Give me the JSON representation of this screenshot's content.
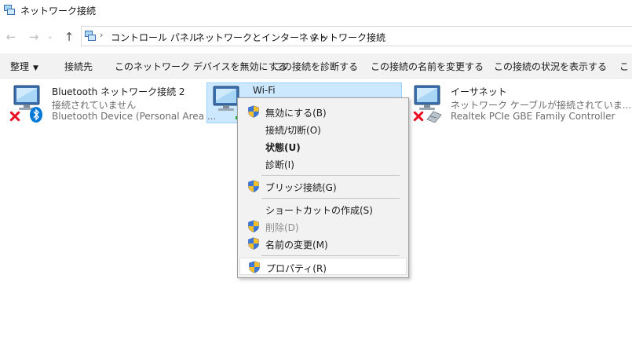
{
  "window": {
    "title": "ネットワーク接続"
  },
  "address": {
    "breadcrumbs": [
      "コントロール パネル",
      "ネットワークとインターネット",
      "ネットワーク接続"
    ]
  },
  "nav": {
    "back_icon": "arrow-left-icon",
    "forward_icon": "arrow-right-icon",
    "recent_icon": "chevron-down-icon",
    "up_icon": "arrow-up-icon"
  },
  "commands": [
    {
      "label": "整理",
      "has_dropdown": true
    },
    {
      "label": "接続先"
    },
    {
      "label": "このネットワーク デバイスを無効にする"
    },
    {
      "label": "この接続を診断する"
    },
    {
      "label": "この接続の名前を変更する"
    },
    {
      "label": "この接続の状況を表示する"
    },
    {
      "label": "こ"
    }
  ],
  "connections": [
    {
      "name": "Bluetooth ネットワーク接続 2",
      "status": "接続されていません",
      "device": "Bluetooth Device (Personal Area ...",
      "icon": "bluetooth-network-icon",
      "disconnected": true
    },
    {
      "name": "Wi-Fi",
      "status": "",
      "device": "",
      "icon": "wifi-network-icon",
      "selected": true
    },
    {
      "name": "イーサネット",
      "status": "ネットワーク ケーブルが接続されていま...",
      "device": "Realtek PCIe GBE Family Controller",
      "icon": "ethernet-network-icon",
      "disconnected": true
    }
  ],
  "context_menu": {
    "items": [
      {
        "label": "無効にする(B)",
        "shield": true
      },
      {
        "label": "接続/切断(O)",
        "shield": false
      },
      {
        "label": "状態(U)",
        "shield": false,
        "bold": true
      },
      {
        "label": "診断(I)",
        "shield": false
      },
      {
        "label": "ブリッジ接続(G)",
        "shield": true
      },
      {
        "label": "ショートカットの作成(S)",
        "shield": false
      },
      {
        "label": "削除(D)",
        "shield": true,
        "disabled": true
      },
      {
        "label": "名前の変更(M)",
        "shield": true
      },
      {
        "label": "プロパティ(R)",
        "shield": true,
        "hover": true
      }
    ]
  },
  "colors": {
    "selection_bg": "#cce8ff",
    "selection_border": "#99d1ff",
    "command_bar_bg": "#f2f2f2",
    "menu_bg": "#f2f2f2",
    "error_red": "#e81123",
    "bluetooth_blue": "#0078d7"
  }
}
